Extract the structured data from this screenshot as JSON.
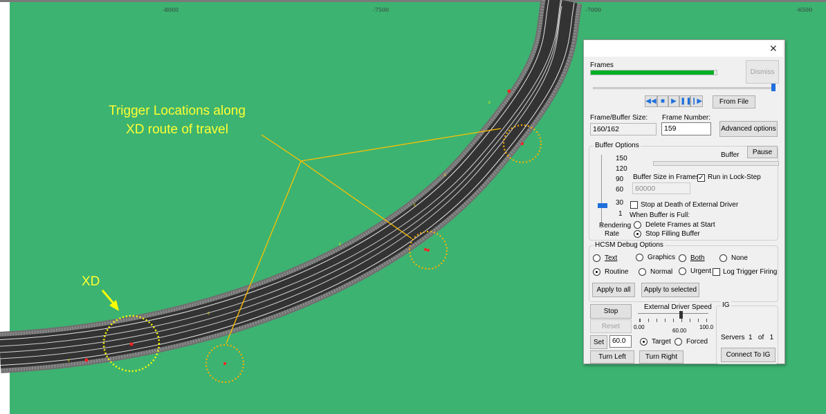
{
  "ruler": {
    "ticks": [
      "-8000",
      "-7500",
      "-7000",
      "-6500"
    ]
  },
  "annotations": {
    "trigger_label_line1": "Trigger Locations along",
    "trigger_label_line2": "XD route of travel",
    "xd_label": "XD"
  },
  "colors": {
    "background": "#3cb371",
    "road": "#3a3a3a",
    "annotation_text": "#ffff33",
    "trigger_circles": "#ffb000",
    "xd_circle": "#ffff00"
  },
  "panel": {
    "close_icon": "close-icon",
    "frames_label": "Frames",
    "dismiss": "Dismiss",
    "frames_progress": 0.98,
    "from_file": "From File",
    "frame_buffer_size_label": "Frame/Buffer Size:",
    "frame_buffer_size_value": "160/162",
    "frame_number_label": "Frame Number:",
    "frame_number_value": "159",
    "advanced_options": "Advanced options",
    "buffer_options": {
      "title": "Buffer Options",
      "buffer_label": "Buffer",
      "pause": "Pause",
      "rendering_rate_values": [
        "150",
        "120",
        "90",
        "60",
        "30",
        "1"
      ],
      "rendering_rate_label_1": "Rendering",
      "rendering_rate_label_2": "Rate",
      "buffer_size_label": "Buffer Size in Frames",
      "buffer_size_value": "60000",
      "run_in_lock_step": "Run in Lock-Step",
      "stop_at_death": "Stop at Death of External Driver",
      "when_full": "When Buffer is Full:",
      "delete_frames": "Delete Frames at Start",
      "stop_filling": "Stop Filling Buffer"
    },
    "hcsm": {
      "title": "HCSM Debug Options",
      "text": "Text",
      "graphics": "Graphics",
      "both": "Both",
      "none": "None",
      "routine": "Routine",
      "normal": "Normal",
      "urgent": "Urgent",
      "log_trigger": "Log Trigger Firing",
      "apply_all": "Apply to all",
      "apply_selected": "Apply to selected"
    },
    "driver": {
      "stop": "Stop",
      "reset": "Reset",
      "set": "Set",
      "set_value": "60.0",
      "turn_left": "Turn Left",
      "turn_right": "Turn Right",
      "speed_label": "External Driver Speed",
      "speed_min": "0.00",
      "speed_mid": "60.00",
      "speed_max": "100.0",
      "target": "Target",
      "forced": "Forced"
    },
    "ig": {
      "title": "IG",
      "servers": "Servers  1   of   1",
      "connect": "Connect To IG"
    }
  }
}
